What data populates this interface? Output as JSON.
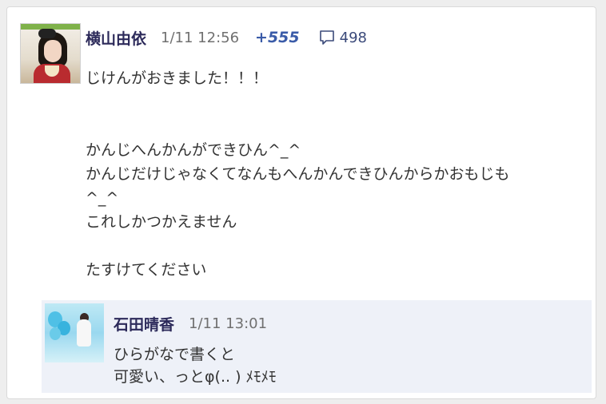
{
  "post": {
    "author": "横山由依",
    "timestamp": "1/11 12:56",
    "likes": "+555",
    "comment_count": "498",
    "body_lines": [
      "じけんがおきました！！！",
      "",
      "",
      "かんじへんかんができひん^_^",
      "かんじだけじゃなくてなんもへんかんできひんからかおもじも",
      "^_^",
      "これしかつかえません",
      "",
      "たすけてください"
    ]
  },
  "reply": {
    "author": "石田晴香",
    "timestamp": "1/11 13:01",
    "body_lines": [
      "ひらがなで書くと",
      "可愛い、っとφ(.. ) ﾒﾓﾒﾓ"
    ]
  },
  "icons": {
    "comment": "speech-bubble-icon"
  },
  "colors": {
    "author": "#2c2a5a",
    "likes": "#3a5ba8",
    "reply_background": "#eef1f8"
  }
}
